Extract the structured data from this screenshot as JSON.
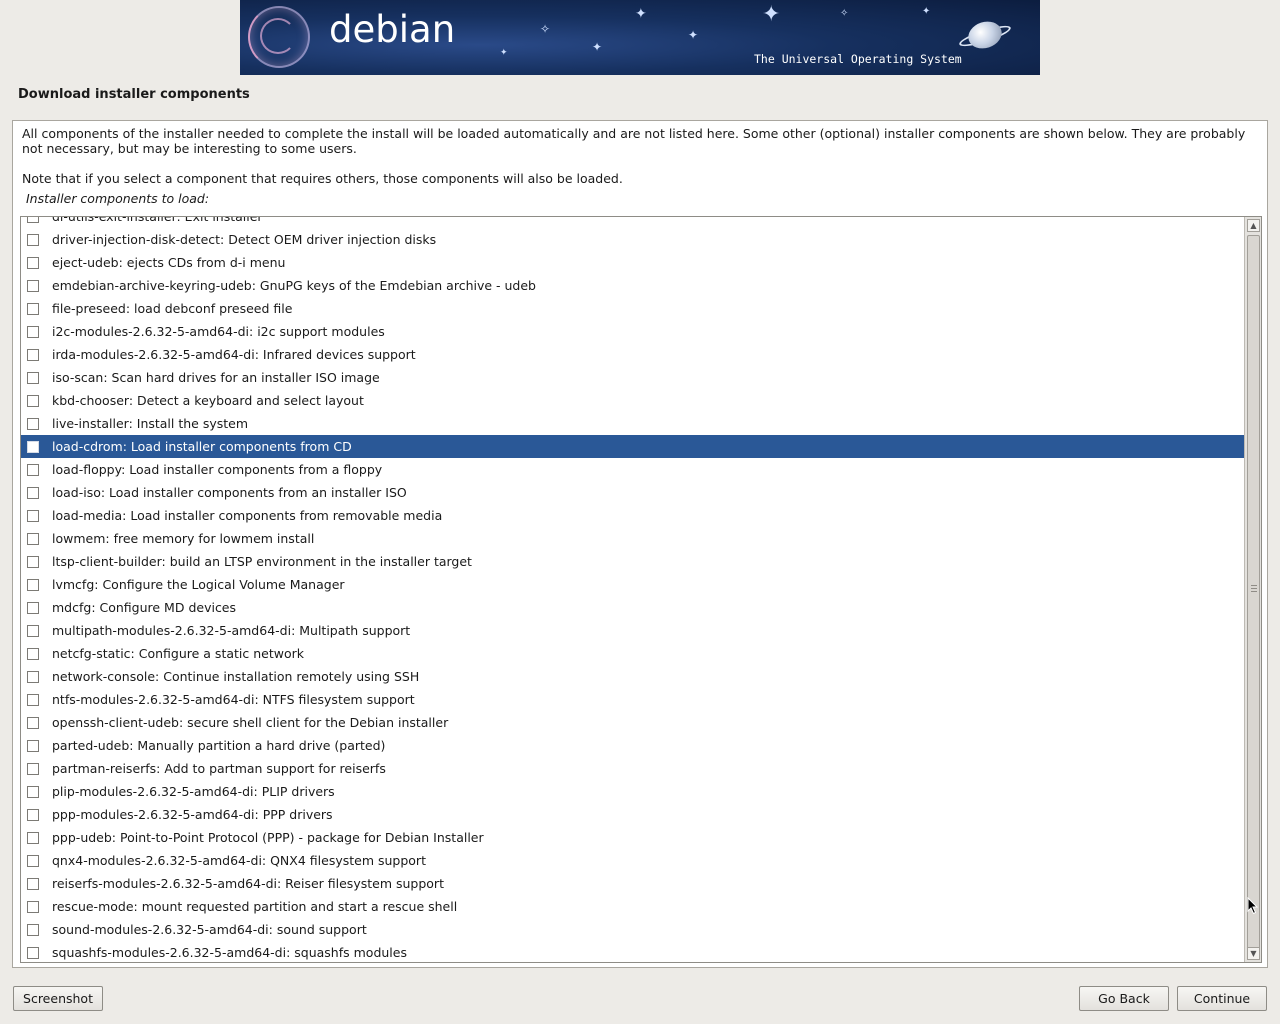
{
  "banner": {
    "logo_text": "debian",
    "tagline": "The Universal Operating System"
  },
  "page_title": "Download installer components",
  "description": "All components of the installer needed to complete the install will be loaded automatically and are not listed here. Some other (optional) installer components are shown below. They are probably not necessary, but may be interesting to some users.",
  "note": "Note that if you select a component that requires others, those components will also be loaded.",
  "list_label": "Installer components to load:",
  "components": [
    {
      "label": "di-utils-exit-installer: Exit installer",
      "checked": false,
      "selected": false
    },
    {
      "label": "driver-injection-disk-detect: Detect OEM driver injection disks",
      "checked": false,
      "selected": false
    },
    {
      "label": "eject-udeb: ejects CDs from d-i menu",
      "checked": false,
      "selected": false
    },
    {
      "label": "emdebian-archive-keyring-udeb: GnuPG keys of the Emdebian archive - udeb",
      "checked": false,
      "selected": false
    },
    {
      "label": "file-preseed: load debconf preseed file",
      "checked": false,
      "selected": false
    },
    {
      "label": "i2c-modules-2.6.32-5-amd64-di: i2c support modules",
      "checked": false,
      "selected": false
    },
    {
      "label": "irda-modules-2.6.32-5-amd64-di: Infrared devices support",
      "checked": false,
      "selected": false
    },
    {
      "label": "iso-scan: Scan hard drives for an installer ISO image",
      "checked": false,
      "selected": false
    },
    {
      "label": "kbd-chooser: Detect a keyboard and select layout",
      "checked": false,
      "selected": false
    },
    {
      "label": "live-installer: Install the system",
      "checked": false,
      "selected": false
    },
    {
      "label": "load-cdrom: Load installer components from CD",
      "checked": false,
      "selected": true
    },
    {
      "label": "load-floppy: Load installer components from a floppy",
      "checked": false,
      "selected": false
    },
    {
      "label": "load-iso: Load installer components from an installer ISO",
      "checked": false,
      "selected": false
    },
    {
      "label": "load-media: Load installer components from removable media",
      "checked": false,
      "selected": false
    },
    {
      "label": "lowmem: free memory for lowmem install",
      "checked": false,
      "selected": false
    },
    {
      "label": "ltsp-client-builder: build an LTSP environment in the installer target",
      "checked": false,
      "selected": false
    },
    {
      "label": "lvmcfg: Configure the Logical Volume Manager",
      "checked": false,
      "selected": false
    },
    {
      "label": "mdcfg: Configure MD devices",
      "checked": false,
      "selected": false
    },
    {
      "label": "multipath-modules-2.6.32-5-amd64-di: Multipath support",
      "checked": false,
      "selected": false
    },
    {
      "label": "netcfg-static: Configure a static network",
      "checked": false,
      "selected": false
    },
    {
      "label": "network-console: Continue installation remotely using SSH",
      "checked": false,
      "selected": false
    },
    {
      "label": "ntfs-modules-2.6.32-5-amd64-di: NTFS filesystem support",
      "checked": false,
      "selected": false
    },
    {
      "label": "openssh-client-udeb: secure shell client for the Debian installer",
      "checked": false,
      "selected": false
    },
    {
      "label": "parted-udeb: Manually partition a hard drive (parted)",
      "checked": false,
      "selected": false
    },
    {
      "label": "partman-reiserfs: Add to partman support for reiserfs",
      "checked": false,
      "selected": false
    },
    {
      "label": "plip-modules-2.6.32-5-amd64-di: PLIP drivers",
      "checked": false,
      "selected": false
    },
    {
      "label": "ppp-modules-2.6.32-5-amd64-di: PPP drivers",
      "checked": false,
      "selected": false
    },
    {
      "label": "ppp-udeb: Point-to-Point Protocol (PPP) - package for Debian Installer",
      "checked": false,
      "selected": false
    },
    {
      "label": "qnx4-modules-2.6.32-5-amd64-di: QNX4 filesystem support",
      "checked": false,
      "selected": false
    },
    {
      "label": "reiserfs-modules-2.6.32-5-amd64-di: Reiser filesystem support",
      "checked": false,
      "selected": false
    },
    {
      "label": "rescue-mode: mount requested partition and start a rescue shell",
      "checked": false,
      "selected": false
    },
    {
      "label": "sound-modules-2.6.32-5-amd64-di: sound support",
      "checked": false,
      "selected": false
    },
    {
      "label": "squashfs-modules-2.6.32-5-amd64-di: squashfs modules",
      "checked": false,
      "selected": false
    }
  ],
  "buttons": {
    "screenshot": "Screenshot",
    "go_back": "Go Back",
    "continue": "Continue"
  },
  "colors": {
    "selection": "#2a5897",
    "background": "#edebe7"
  }
}
